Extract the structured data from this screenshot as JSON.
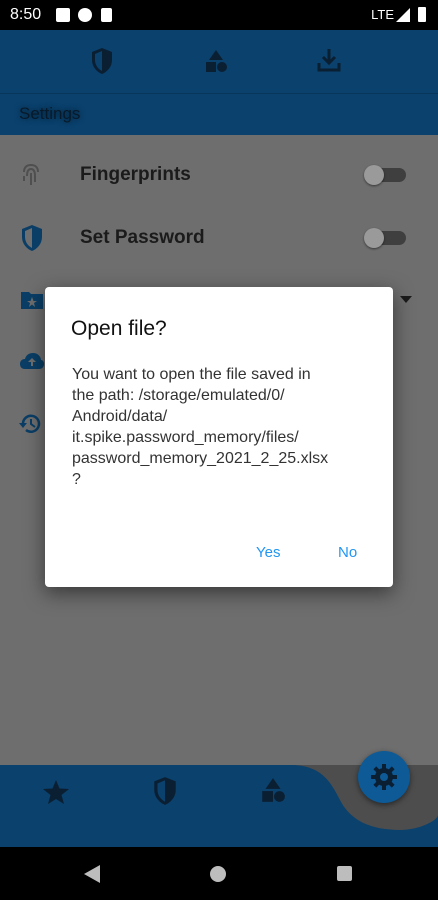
{
  "status_bar": {
    "time": "8:50",
    "network": "LTE"
  },
  "top_bar": {
    "icons": [
      "shield-icon",
      "shapes-icon",
      "download-icon"
    ]
  },
  "settings_header": {
    "title": "Settings"
  },
  "settings_items": [
    {
      "label": "Fingerprints",
      "icon": "fingerprint-icon",
      "enabled": false
    },
    {
      "label": "Set Password",
      "icon": "shield-icon",
      "enabled": false
    }
  ],
  "dialog": {
    "title": "Open file?",
    "message_lines": [
      "You want to open the file saved in",
      "the path: /storage/emulated/0/",
      "Android/data/",
      "it.spike.password_memory/files/",
      "password_memory_2021_2_25.xlsx",
      "?"
    ],
    "yes_label": "Yes",
    "no_label": "No"
  },
  "bottom_nav": {
    "icons": [
      "star-icon",
      "shield-icon",
      "shapes-icon",
      "gear-icon"
    ]
  },
  "colors": {
    "primary": "#0a416d",
    "accent": "#2196f3",
    "scrim": "#6e6e6e"
  }
}
